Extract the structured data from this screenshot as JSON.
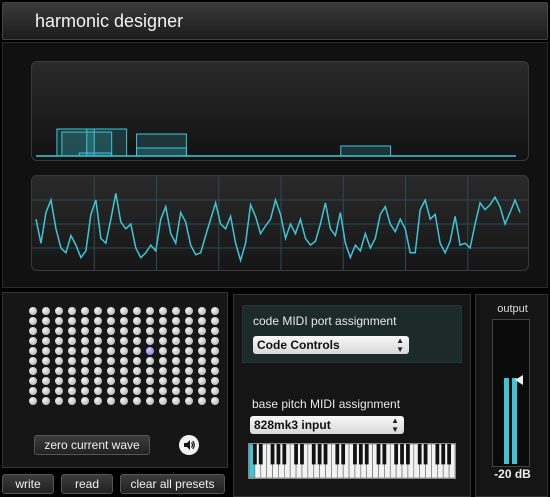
{
  "app": {
    "title": "harmonic designer"
  },
  "visualizer": {
    "spectrum_bars": [
      {
        "from": 0.05,
        "to": 0.125,
        "level": 0.27
      },
      {
        "from": 0.06,
        "to": 0.16,
        "level": 0.24
      },
      {
        "from": 0.095,
        "to": 0.16,
        "level": 0.03
      },
      {
        "from": 0.11,
        "to": 0.19,
        "level": 0.27
      },
      {
        "from": 0.21,
        "to": 0.31,
        "level": 0.22
      },
      {
        "from": 0.21,
        "to": 0.31,
        "level": 0.08
      },
      {
        "from": 0.62,
        "to": 0.72,
        "level": 0.1
      }
    ],
    "waveform": [
      0.55,
      0.3,
      0.62,
      0.75,
      0.45,
      0.25,
      0.2,
      0.38,
      0.28,
      0.15,
      0.22,
      0.6,
      0.75,
      0.35,
      0.3,
      0.55,
      0.82,
      0.52,
      0.45,
      0.5,
      0.25,
      0.15,
      0.2,
      0.28,
      0.22,
      0.55,
      0.68,
      0.4,
      0.3,
      0.62,
      0.52,
      0.28,
      0.18,
      0.2,
      0.38,
      0.55,
      0.72,
      0.5,
      0.45,
      0.58,
      0.3,
      0.12,
      0.3,
      0.7,
      0.58,
      0.4,
      0.48,
      0.55,
      0.75,
      0.6,
      0.35,
      0.5,
      0.4,
      0.55,
      0.35,
      0.28,
      0.32,
      0.5,
      0.72,
      0.45,
      0.38,
      0.62,
      0.3,
      0.15,
      0.28,
      0.22,
      0.4,
      0.25,
      0.35,
      0.6,
      0.68,
      0.5,
      0.42,
      0.55,
      0.45,
      0.2,
      0.2,
      0.65,
      0.75,
      0.55,
      0.6,
      0.3,
      0.2,
      0.32,
      0.58,
      0.28,
      0.3,
      0.25,
      0.5,
      0.72,
      0.65,
      0.7,
      0.78,
      0.68,
      0.5,
      0.62,
      0.75,
      0.62
    ],
    "colors": {
      "accent": "#3ec6d6",
      "grid": "#2a4a55"
    }
  },
  "presets": {
    "rows": 10,
    "cols": 15,
    "active_row": 4,
    "active_col": 9,
    "zero_button": "zero current wave",
    "speaker_icon": "speaker-icon"
  },
  "bottom_bar": {
    "write": "write",
    "read": "read",
    "clear": "clear all presets"
  },
  "midi": {
    "code_port_label": "code MIDI port assignment",
    "code_port_value": "Code Controls",
    "base_pitch_label": "base pitch MIDI assignment",
    "base_pitch_value": "828mk3 input",
    "keyboard_octaves": 5,
    "highlighted_key": 0
  },
  "output": {
    "label": "output",
    "db_label": "-20 dB",
    "level_left": 0.6,
    "level_right": 0.6
  }
}
